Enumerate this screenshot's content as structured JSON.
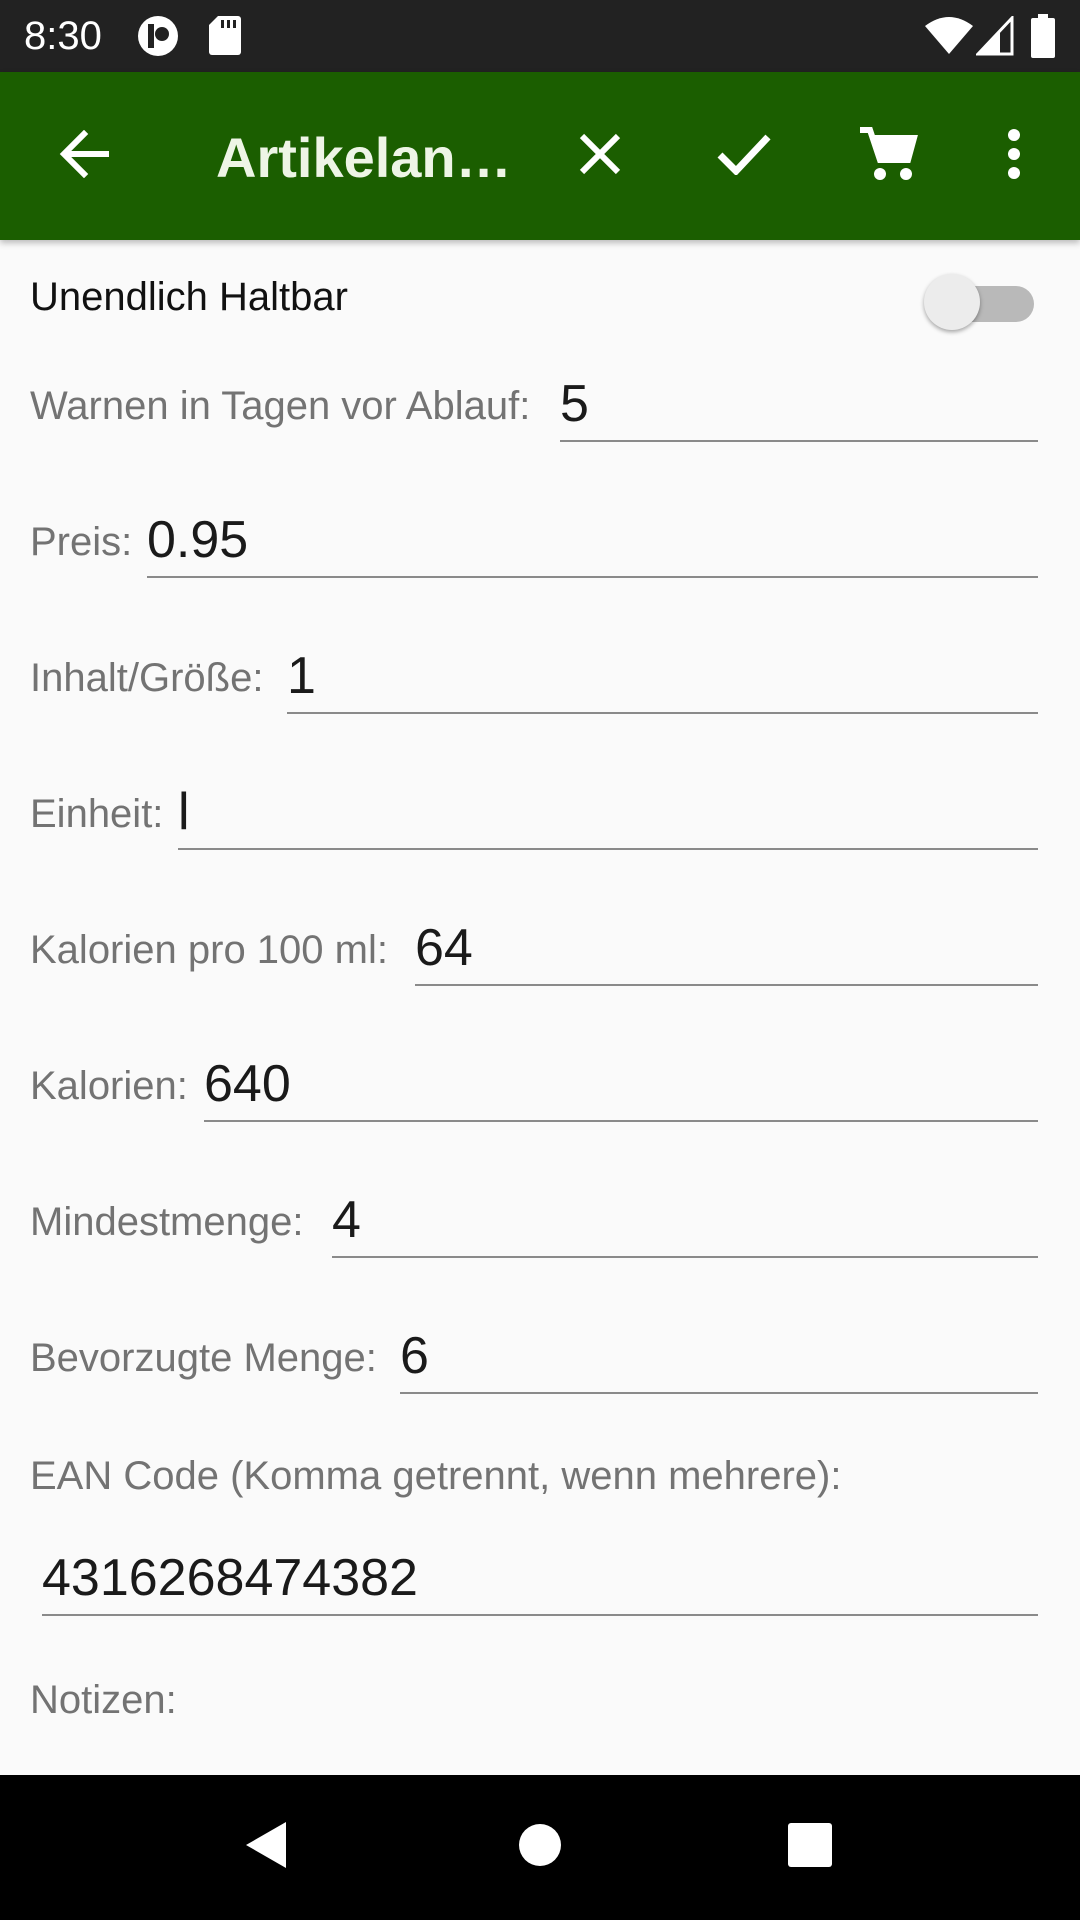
{
  "status_bar": {
    "time": "8:30",
    "icons": [
      "app-notification-icon",
      "sd-card-icon",
      "wifi-icon",
      "cell-signal-icon",
      "battery-icon"
    ]
  },
  "app_bar": {
    "background_color": "#1b5e00",
    "title": "Artikelan…",
    "actions": [
      "back-arrow-icon",
      "close-icon",
      "check-icon",
      "cart-icon",
      "more-vert-icon"
    ]
  },
  "form": {
    "infinite_shelf_life": {
      "label": "Unendlich Haltbar",
      "checked": false
    },
    "warn_days": {
      "label": "Warnen in Tagen vor Ablauf:",
      "value": "5"
    },
    "price": {
      "label": "Preis:",
      "value": "0.95"
    },
    "content_size": {
      "label": "Inhalt/Größe:",
      "value": "1"
    },
    "unit": {
      "label": "Einheit:",
      "value": "l"
    },
    "calories_per_100": {
      "label": "Kalorien pro 100 ml:",
      "value": "64"
    },
    "calories": {
      "label": "Kalorien:",
      "value": "640"
    },
    "min_quantity": {
      "label": "Mindestmenge:",
      "value": "4"
    },
    "preferred_quantity": {
      "label": "Bevorzugte Menge:",
      "value": "6"
    },
    "ean": {
      "label": "EAN Code (Komma getrennt, wenn mehrere):",
      "value": "4316268474382"
    },
    "notes": {
      "label": "Notizen:"
    }
  },
  "nav_bar": {
    "buttons": [
      "back-triangle-icon",
      "home-circle-icon",
      "recents-square-icon"
    ]
  }
}
